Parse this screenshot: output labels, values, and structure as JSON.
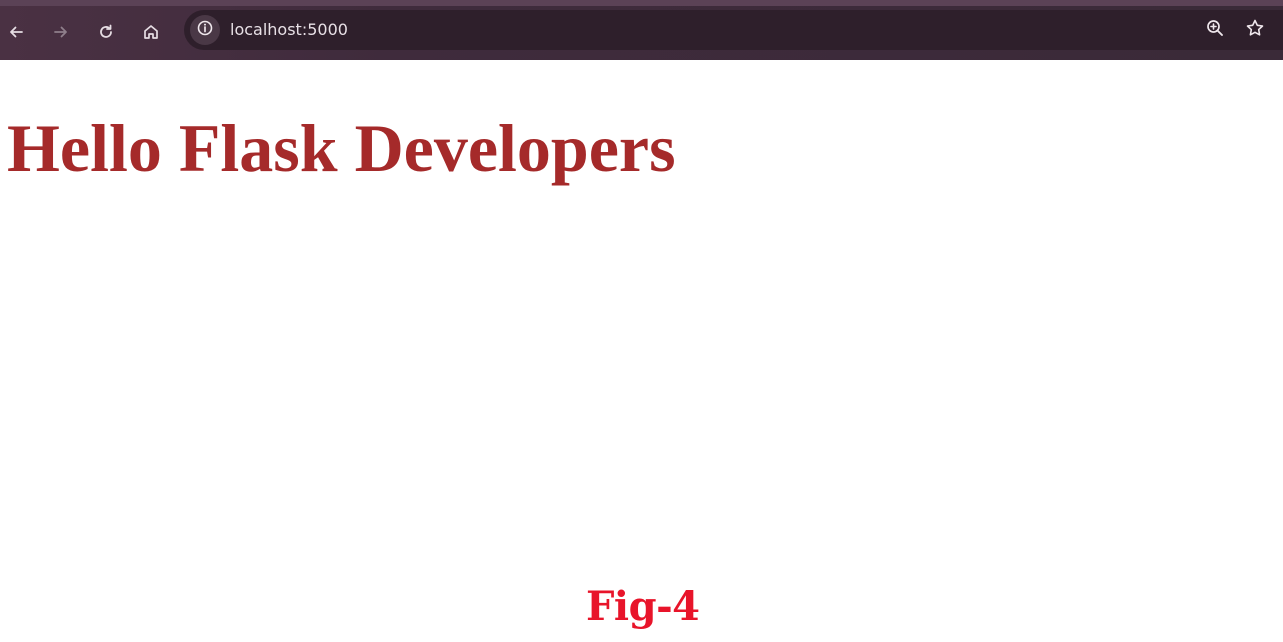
{
  "browser": {
    "url": "localhost:5000",
    "buttons": {
      "back": "back-arrow-icon",
      "forward": "forward-arrow-icon",
      "reload": "reload-icon",
      "home": "home-icon",
      "site_info": "info-icon",
      "zoom": "zoom-in-icon",
      "bookmark": "star-icon"
    }
  },
  "page": {
    "heading": "Hello Flask Developers",
    "caption": "Fig-4"
  },
  "colors": {
    "heading": "#a52a2a",
    "caption": "#e8142a",
    "toolbar": "#3f2b3c"
  }
}
